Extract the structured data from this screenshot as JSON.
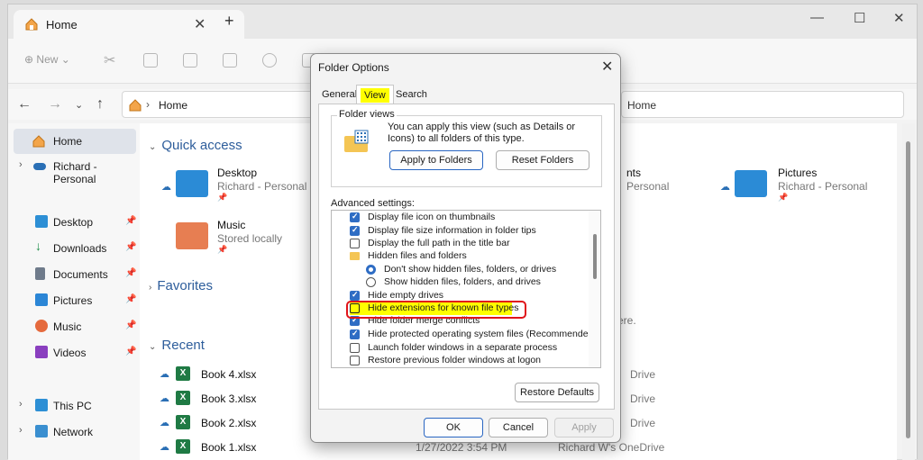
{
  "tab": {
    "title": "Home"
  },
  "toolbar": {
    "new_label": "New"
  },
  "address": {
    "location": "Home",
    "location2": "Home"
  },
  "nav": {
    "items": [
      {
        "label": "Home"
      },
      {
        "label": "Richard - Personal"
      },
      {
        "label": "Desktop"
      },
      {
        "label": "Downloads"
      },
      {
        "label": "Documents"
      },
      {
        "label": "Pictures"
      },
      {
        "label": "Music"
      },
      {
        "label": "Videos"
      },
      {
        "label": "This PC"
      },
      {
        "label": "Network"
      }
    ]
  },
  "main": {
    "quick_access": "Quick access",
    "favorites": "Favorites",
    "recent": "Recent",
    "qa_items": [
      {
        "title": "Desktop",
        "sub": "Richard - Personal"
      },
      {
        "title": "Music",
        "sub": "Stored locally"
      },
      {
        "title": "Pictures",
        "sub": "Richard - Personal"
      }
    ],
    "partial": {
      "nts": "nts",
      "personal": "Personal",
      "here": "ere.",
      "drive": "Drive",
      "date": "1/27/2022 3:54 PM",
      "onedrive": "Richard W's OneDrive"
    },
    "recent_files": [
      {
        "name": "Book 4.xlsx"
      },
      {
        "name": "Book 3.xlsx"
      },
      {
        "name": "Book 2.xlsx"
      },
      {
        "name": "Book 1.xlsx"
      }
    ]
  },
  "dialog": {
    "title": "Folder Options",
    "tabs": [
      "General",
      "View",
      "Search"
    ],
    "folder_views_label": "Folder views",
    "folder_views_text": "You can apply this view (such as Details or Icons) to all folders of this type.",
    "apply_to_folders": "Apply to Folders",
    "reset_folders": "Reset Folders",
    "advanced_label": "Advanced settings:",
    "advanced_rows": [
      {
        "text": "Display file icon on thumbnails",
        "kind": "check",
        "checked": true
      },
      {
        "text": "Display file size information in folder tips",
        "kind": "check",
        "checked": true
      },
      {
        "text": "Display the full path in the title bar",
        "kind": "check",
        "checked": false
      },
      {
        "text": "Hidden files and folders",
        "kind": "folder"
      },
      {
        "text": "Don't show hidden files, folders, or drives",
        "kind": "radio",
        "checked": true
      },
      {
        "text": "Show hidden files, folders, and drives",
        "kind": "radio",
        "checked": false
      },
      {
        "text": "Hide empty drives",
        "kind": "check",
        "checked": true
      },
      {
        "text": "Hide extensions for known file types",
        "kind": "check",
        "checked": false
      },
      {
        "text": "Hide folder merge conflicts",
        "kind": "check",
        "checked": true
      },
      {
        "text": "Hide protected operating system files (Recommended)",
        "kind": "check",
        "checked": true
      },
      {
        "text": "Launch folder windows in a separate process",
        "kind": "check",
        "checked": false
      },
      {
        "text": "Restore previous folder windows at logon",
        "kind": "check",
        "checked": false
      }
    ],
    "restore_defaults": "Restore Defaults",
    "ok": "OK",
    "cancel": "Cancel",
    "apply": "Apply"
  },
  "icons": {
    "home": "home-icon",
    "close": "close-icon",
    "plus": "plus-icon",
    "folder": "folder-icon",
    "cloud": "cloud-icon",
    "excel": "excel-icon",
    "pin": "pin-icon"
  },
  "colors": {
    "accent": "#2f6dc4",
    "highlight": "#ffff00",
    "callout": "#e0141a",
    "excel": "#1f7a44"
  }
}
